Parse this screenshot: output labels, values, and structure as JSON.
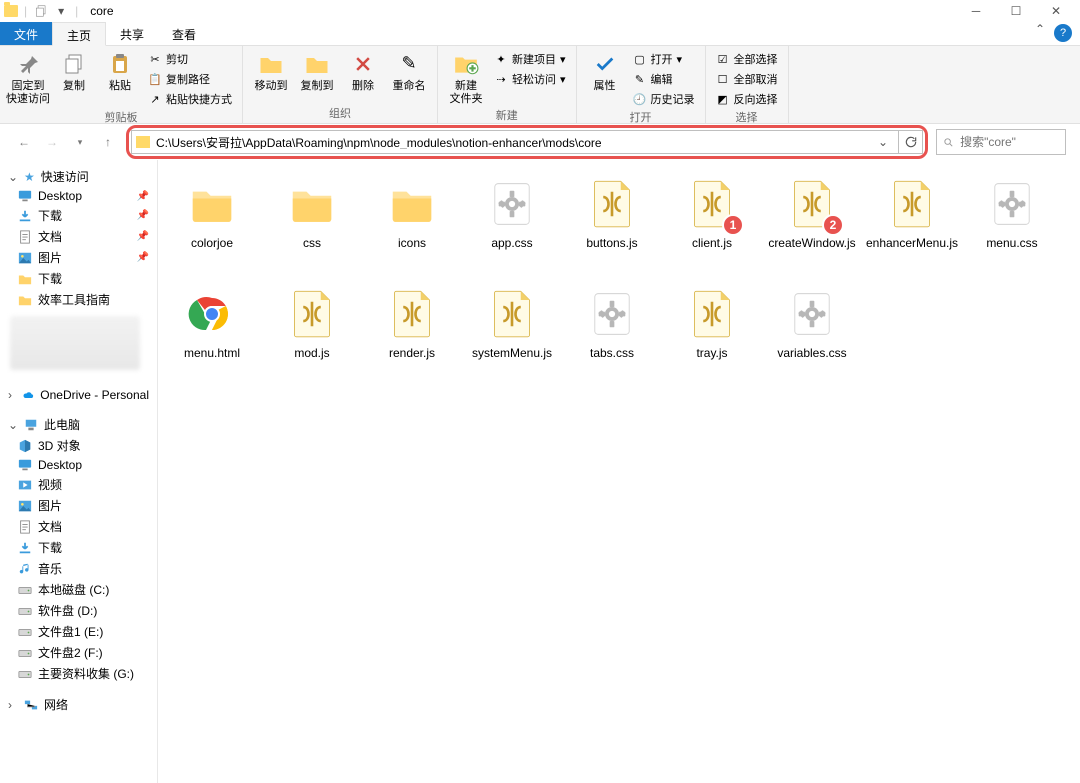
{
  "titlebar": {
    "title": "core"
  },
  "tabs": {
    "file": "文件",
    "home": "主页",
    "share": "共享",
    "view": "查看"
  },
  "ribbon": {
    "clipboard": {
      "pin": "固定到\n快速访问",
      "copy": "复制",
      "paste": "粘贴",
      "cut": "剪切",
      "copypath": "复制路径",
      "pasteshortcut": "粘贴快捷方式",
      "label": "剪贴板"
    },
    "organize": {
      "moveto": "移动到",
      "copyto": "复制到",
      "delete": "删除",
      "rename": "重命名",
      "label": "组织"
    },
    "new": {
      "newfolder": "新建\n文件夹",
      "newitem": "新建项目",
      "easyaccess": "轻松访问",
      "label": "新建"
    },
    "open": {
      "properties": "属性",
      "open": "打开",
      "edit": "编辑",
      "history": "历史记录",
      "label": "打开"
    },
    "select": {
      "selectall": "全部选择",
      "selectnone": "全部取消",
      "invert": "反向选择",
      "label": "选择"
    }
  },
  "address": {
    "path": "C:\\Users\\安哥拉\\AppData\\Roaming\\npm\\node_modules\\notion-enhancer\\mods\\core",
    "search_placeholder": "搜索\"core\""
  },
  "sidebar": {
    "quickaccess": "快速访问",
    "items1": [
      {
        "label": "Desktop",
        "icon": "desktop"
      },
      {
        "label": "下载",
        "icon": "download"
      },
      {
        "label": "文档",
        "icon": "doc"
      },
      {
        "label": "图片",
        "icon": "pic"
      },
      {
        "label": "下载",
        "icon": "folder"
      },
      {
        "label": "效率工具指南",
        "icon": "folder"
      }
    ],
    "onedrive": "OneDrive - Personal",
    "thispc": "此电脑",
    "items2": [
      {
        "label": "3D 对象",
        "icon": "3d"
      },
      {
        "label": "Desktop",
        "icon": "desktop"
      },
      {
        "label": "视频",
        "icon": "video"
      },
      {
        "label": "图片",
        "icon": "pic"
      },
      {
        "label": "文档",
        "icon": "doc"
      },
      {
        "label": "下载",
        "icon": "download"
      },
      {
        "label": "音乐",
        "icon": "music"
      },
      {
        "label": "本地磁盘 (C:)",
        "icon": "drive"
      },
      {
        "label": "软件盘 (D:)",
        "icon": "drive"
      },
      {
        "label": "文件盘1 (E:)",
        "icon": "drive"
      },
      {
        "label": "文件盘2 (F:)",
        "icon": "drive"
      },
      {
        "label": "主要资料收集 (G:)",
        "icon": "drive"
      }
    ],
    "network": "网络"
  },
  "files": [
    {
      "name": "colorjoe",
      "type": "folder"
    },
    {
      "name": "css",
      "type": "folder"
    },
    {
      "name": "icons",
      "type": "folder"
    },
    {
      "name": "app.css",
      "type": "css"
    },
    {
      "name": "buttons.js",
      "type": "js"
    },
    {
      "name": "client.js",
      "type": "js",
      "badge": "1"
    },
    {
      "name": "createWindow.js",
      "type": "js",
      "badge": "2"
    },
    {
      "name": "enhancerMenu.js",
      "type": "js"
    },
    {
      "name": "menu.css",
      "type": "css"
    },
    {
      "name": "menu.html",
      "type": "html"
    },
    {
      "name": "mod.js",
      "type": "js"
    },
    {
      "name": "render.js",
      "type": "js"
    },
    {
      "name": "systemMenu.js",
      "type": "js"
    },
    {
      "name": "tabs.css",
      "type": "css"
    },
    {
      "name": "tray.js",
      "type": "js"
    },
    {
      "name": "variables.css",
      "type": "css"
    }
  ]
}
